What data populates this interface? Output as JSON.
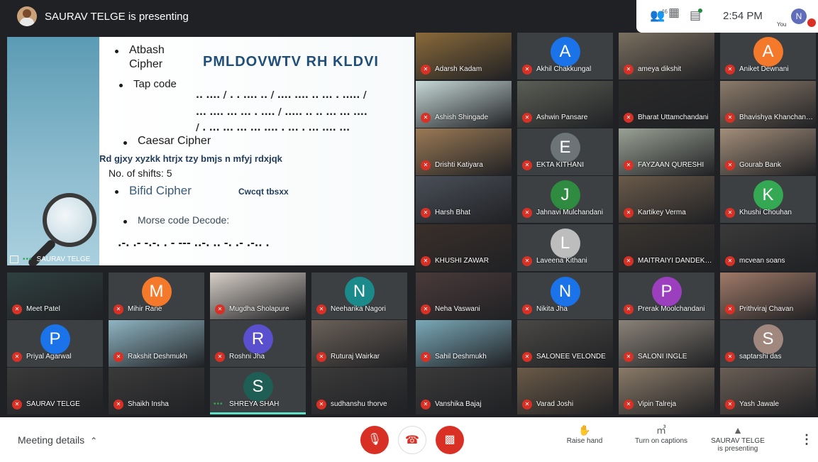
{
  "header": {
    "presenter_title": "SAURAV TELGE is presenting",
    "participant_count": "46",
    "time": "2:54 PM",
    "you_label": "You",
    "you_initial": "N"
  },
  "slide": {
    "bullet_atbash_1": "Atbash",
    "bullet_atbash_2": "Cipher",
    "atbash_text": "PMLDOVWTV RH KLDVI",
    "bullet_tap": "Tap code",
    "tap_line_1": ".. .... / . .  .... .. / .... ....  .. ...  . ..... /",
    "tap_line_2": "... ....  ... ...  . .... / ..... ..  .. ...  ... ....",
    "tap_line_3": "/ . ...  ... ...  ... ....  . ...  . ...  .... ...",
    "bullet_caesar": "Caesar Cipher",
    "caesar_text": "Rd   gjxy  xyzkk  htrjx  tzy  bmjs  n  mfyj  rdxjqk",
    "shifts": "No. of shifts: 5",
    "bullet_bifid": "Bifid Cipher",
    "bifid_text": "Cwcqt tbsxx",
    "bullet_morse": "Morse code   Decode:",
    "morse_text": ".-.  .- -.-. .   - ---  ..-. ..  -. .- .-.. .",
    "presenter_label": "SAURAV TELGE"
  },
  "participants": [
    {
      "name": "Adarsh Kadam",
      "kind": "photo",
      "color": "#8a6a3a"
    },
    {
      "name": "Akhil Chakkungal",
      "kind": "initial",
      "initial": "A",
      "color": "#1a73e8"
    },
    {
      "name": "ameya dikshit",
      "kind": "photo",
      "color": "#7a6f60"
    },
    {
      "name": "Aniket Dewnani",
      "kind": "initial",
      "initial": "A",
      "color": "#f4792a"
    },
    {
      "name": "Ashish Shingade",
      "kind": "photo",
      "color": "#c7d9d6"
    },
    {
      "name": "Ashwin Pansare",
      "kind": "photo",
      "color": "#5b5e55"
    },
    {
      "name": "Bharat Uttamchandani",
      "kind": "photo",
      "color": "#2a2a2a"
    },
    {
      "name": "Bhavishya Khanchandani",
      "kind": "photo",
      "color": "#8b7b6a"
    },
    {
      "name": "Drishti Katiyara",
      "kind": "photo",
      "color": "#9b7a55"
    },
    {
      "name": "EKTA KITHANI",
      "kind": "initial",
      "initial": "E",
      "color": "#6c7478"
    },
    {
      "name": "FAYZAAN QURESHI",
      "kind": "photo",
      "color": "#9aa194"
    },
    {
      "name": "Gourab Bank",
      "kind": "photo",
      "color": "#a38e7a"
    },
    {
      "name": "Harsh Bhat",
      "kind": "photo",
      "color": "#4a4f58"
    },
    {
      "name": "Jahnavi Mulchandani",
      "kind": "initial",
      "initial": "J",
      "color": "#2e8b40"
    },
    {
      "name": "Kartikey Verma",
      "kind": "photo",
      "color": "#6a5a4a"
    },
    {
      "name": "Khushi Chouhan",
      "kind": "initial",
      "initial": "K",
      "color": "#34a853"
    },
    {
      "name": "KHUSHI ZAWAR",
      "kind": "photo",
      "color": "#3a2f2a"
    },
    {
      "name": "Laveena Kithani",
      "kind": "initial",
      "initial": "L",
      "color": "#bdbdbd"
    },
    {
      "name": "MAITRAIYI DANDEKAR",
      "kind": "photo",
      "color": "#3a3530"
    },
    {
      "name": "mcvean soans",
      "kind": "photo",
      "color": "#3a3a3a"
    },
    {
      "name": "Meet Patel",
      "kind": "photo",
      "color": "#2f4040"
    },
    {
      "name": "Mihir Rane",
      "kind": "initial",
      "initial": "M",
      "color": "#f4792a"
    },
    {
      "name": "Mugdha Sholapure",
      "kind": "photo",
      "color": "#d8d0c8"
    },
    {
      "name": "Neeharika Nagori",
      "kind": "initial",
      "initial": "N",
      "color": "#1a8a8a"
    },
    {
      "name": "Neha Vaswani",
      "kind": "photo",
      "color": "#4a3a3a"
    },
    {
      "name": "Nikita Jha",
      "kind": "initial",
      "initial": "N",
      "color": "#1a73e8"
    },
    {
      "name": "Prerak Moolchandani",
      "kind": "initial",
      "initial": "P",
      "color": "#9c3fbf"
    },
    {
      "name": "Prithviraj Chavan",
      "kind": "photo",
      "color": "#a07a68"
    },
    {
      "name": "Priyal Agarwal",
      "kind": "initial",
      "initial": "P",
      "color": "#1a73e8"
    },
    {
      "name": "Rakshit Deshmukh",
      "kind": "photo",
      "color": "#8fb5c2"
    },
    {
      "name": "Roshni Jha",
      "kind": "initial",
      "initial": "R",
      "color": "#5a4fcf"
    },
    {
      "name": "Ruturaj Wairkar",
      "kind": "photo",
      "color": "#6a6058"
    },
    {
      "name": "Sahil Deshmukh",
      "kind": "photo",
      "color": "#7aa9b8"
    },
    {
      "name": "SALONEE VELONDE",
      "kind": "photo",
      "color": "#4a4845"
    },
    {
      "name": "SALONI INGLE",
      "kind": "photo",
      "color": "#8a8278"
    },
    {
      "name": "saptarshi das",
      "kind": "initial",
      "initial": "S",
      "color": "#a1887f"
    },
    {
      "name": "SAURAV TELGE",
      "kind": "photo",
      "color": "#3a3a3a"
    },
    {
      "name": "Shaikh Insha",
      "kind": "photo",
      "color": "#3a3a3a"
    },
    {
      "name": "SHREYA SHAH",
      "kind": "initial",
      "initial": "S",
      "color": "#1f5e55",
      "talking": true
    },
    {
      "name": "sudhanshu thorve",
      "kind": "photo",
      "color": "#3a3a3a"
    },
    {
      "name": "Vanshika Bajaj",
      "kind": "photo",
      "color": "#3a3a3a"
    },
    {
      "name": "Varad Joshi",
      "kind": "photo",
      "color": "#6a5a48"
    },
    {
      "name": "Vipin Talreja",
      "kind": "photo",
      "color": "#8a7a68"
    },
    {
      "name": "Yash Jawale",
      "kind": "photo",
      "color": "#6a5e55"
    }
  ],
  "bottom": {
    "meeting_details": "Meeting details",
    "raise_hand": "Raise hand",
    "captions": "Turn on captions",
    "presenting_name": "SAURAV TELGE",
    "presenting_sub": "is presenting"
  }
}
